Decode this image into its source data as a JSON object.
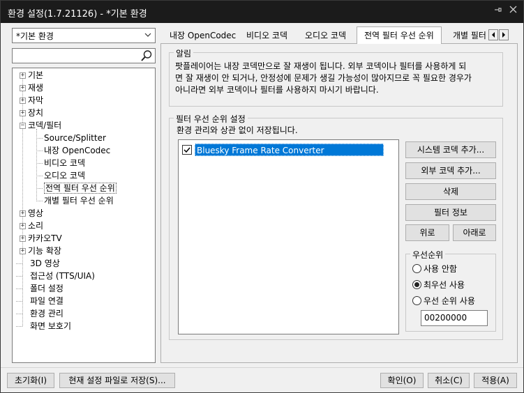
{
  "window": {
    "title": "환경 설정(1.7.21126) - *기본 환경",
    "pin_icon": "pin-icon",
    "close_icon": "close-icon"
  },
  "left_panel": {
    "preset_value": "*기본 환경",
    "search_value": "",
    "tree": [
      {
        "label": "기본",
        "expander": "+",
        "level": 0
      },
      {
        "label": "재생",
        "expander": "+",
        "level": 0
      },
      {
        "label": "자막",
        "expander": "+",
        "level": 0
      },
      {
        "label": "장치",
        "expander": "+",
        "level": 0
      },
      {
        "label": "코덱/필터",
        "expander": "-",
        "level": 0
      },
      {
        "label": "Source/Splitter",
        "expander": "",
        "level": 1
      },
      {
        "label": "내장 OpenCodec",
        "expander": "",
        "level": 1
      },
      {
        "label": "비디오 코덱",
        "expander": "",
        "level": 1
      },
      {
        "label": "오디오 코덱",
        "expander": "",
        "level": 1
      },
      {
        "label": "전역 필터 우선 순위",
        "expander": "",
        "level": 1,
        "selected": true
      },
      {
        "label": "개별 필터 우선 순위",
        "expander": "",
        "level": 1
      },
      {
        "label": "영상",
        "expander": "+",
        "level": 0
      },
      {
        "label": "소리",
        "expander": "+",
        "level": 0
      },
      {
        "label": "카카오TV",
        "expander": "+",
        "level": 0
      },
      {
        "label": "기능 확장",
        "expander": "+",
        "level": 0
      },
      {
        "label": "3D 영상",
        "expander": "",
        "level": 0
      },
      {
        "label": "접근성 (TTS/UIA)",
        "expander": "",
        "level": 0
      },
      {
        "label": "폴더 설정",
        "expander": "",
        "level": 0
      },
      {
        "label": "파일 연결",
        "expander": "",
        "level": 0
      },
      {
        "label": "환경 관리",
        "expander": "",
        "level": 0
      },
      {
        "label": "화면 보호기",
        "expander": "",
        "level": 0
      }
    ]
  },
  "tabs": [
    {
      "label": "내장 OpenCodec",
      "active": false
    },
    {
      "label": "비디오 코덱",
      "active": false
    },
    {
      "label": "오디오 코덱",
      "active": false
    },
    {
      "label": "전역 필터 우선 순위",
      "active": true
    },
    {
      "label": "개별 필터",
      "active": false
    }
  ],
  "notice": {
    "title": "알림",
    "lines": [
      "팟플레이어는 내장 코덱만으로 잘 재생이 됩니다. 외부 코덱이나 필터를 사용하게 되",
      "면 잘 재생이 안 되거나, 안정성에 문제가 생길 가능성이 많아지므로 꼭 필요한 경우가",
      "아니라면 외부 코덱이나 필터를 사용하지 마시기 바랍니다."
    ]
  },
  "filter_priority": {
    "title": "필터 우선 순위 설정",
    "description": "환경 관리와 상관 없이 저장됩니다.",
    "items": [
      {
        "label": "Bluesky Frame Rate Converter",
        "checked": true,
        "selected": true
      }
    ],
    "buttons": {
      "add_system_codec": "시스템 코덱 추가...",
      "add_external_codec": "외부 코덱 추가...",
      "delete": "삭제",
      "filter_info": "필터 정보",
      "up": "위로",
      "down": "아래로"
    },
    "priority": {
      "title": "우선순위",
      "options": [
        "사용 안함",
        "최우선 사용",
        "우선 순위 사용"
      ],
      "selected": "최우선 사용",
      "value": "00200000"
    }
  },
  "footer": {
    "reset": "초기화(I)",
    "save_current": "현재 설정 파일로 저장(S)...",
    "ok": "확인(O)",
    "cancel": "취소(C)",
    "apply": "적용(A)"
  }
}
